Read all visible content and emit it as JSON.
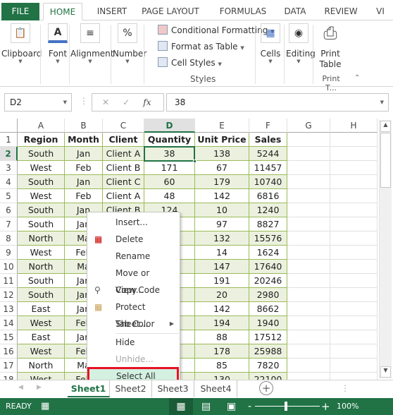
{
  "ribbon_tabs": [
    "FILE",
    "HOME",
    "INSERT",
    "PAGE LAYOUT",
    "FORMULAS",
    "DATA",
    "REVIEW",
    "VI"
  ],
  "groups": {
    "clipboard": "Clipboard",
    "font": "Font",
    "alignment": "Alignment",
    "number": "Number",
    "number_icon": "%",
    "font_icon": "A",
    "styles": {
      "conditional": "Conditional Formatting",
      "format_table": "Format as Table",
      "cell_styles": "Cell Styles",
      "label": "Styles"
    },
    "cells": "Cells",
    "editing": "Editing",
    "print_table": "Print Table",
    "print_label": "Print T..."
  },
  "formula_bar": {
    "name_box": "D2",
    "fx": "fx",
    "value": "38"
  },
  "columns": [
    "A",
    "B",
    "C",
    "D",
    "E",
    "F",
    "G",
    "H"
  ],
  "selected_column": "D",
  "selected_row": "2",
  "table": {
    "headers": [
      "Region",
      "Month",
      "Client",
      "Quantity",
      "Unit Price",
      "Sales"
    ],
    "rows": [
      [
        "South",
        "Jan",
        "Client A",
        "38",
        "138",
        "5244"
      ],
      [
        "West",
        "Feb",
        "Client B",
        "171",
        "67",
        "11457"
      ],
      [
        "South",
        "Jan",
        "Client C",
        "60",
        "179",
        "10740"
      ],
      [
        "West",
        "Feb",
        "Client A",
        "48",
        "142",
        "6816"
      ],
      [
        "South",
        "Jan",
        "Client B",
        "124",
        "10",
        "1240"
      ],
      [
        "South",
        "Jan",
        "",
        "",
        "97",
        "8827"
      ],
      [
        "North",
        "Ma",
        "",
        "",
        "132",
        "15576"
      ],
      [
        "West",
        "Feb",
        "",
        "",
        "14",
        "1624"
      ],
      [
        "North",
        "Ma",
        "",
        "",
        "147",
        "17640"
      ],
      [
        "South",
        "Jan",
        "",
        "",
        "191",
        "20246"
      ],
      [
        "South",
        "Jan",
        "",
        "",
        "20",
        "2980"
      ],
      [
        "East",
        "Jan",
        "",
        "",
        "142",
        "8662"
      ],
      [
        "West",
        "Feb",
        "",
        "",
        "194",
        "1940"
      ],
      [
        "East",
        "Jan",
        "",
        "",
        "88",
        "17512"
      ],
      [
        "West",
        "Feb",
        "",
        "",
        "178",
        "25988"
      ],
      [
        "North",
        "Ma",
        "",
        "",
        "85",
        "7820"
      ],
      [
        "West",
        "Feb",
        "",
        "",
        "130",
        "22100"
      ]
    ]
  },
  "context_menu": [
    {
      "label": "Insert...",
      "icon": "",
      "disabled": false
    },
    {
      "label": "Delete",
      "icon": "delete-sheet-icon",
      "disabled": false
    },
    {
      "label": "Rename",
      "icon": "",
      "disabled": false
    },
    {
      "label": "Move or Copy...",
      "icon": "",
      "disabled": false
    },
    {
      "label": "View Code",
      "icon": "view-code-icon",
      "disabled": false
    },
    {
      "label": "Protect Sheet...",
      "icon": "protect-sheet-icon",
      "disabled": false
    },
    {
      "label": "Tab Color",
      "icon": "",
      "disabled": false,
      "submenu": true
    },
    {
      "label": "Hide",
      "icon": "",
      "disabled": false
    },
    {
      "label": "Unhide...",
      "icon": "",
      "disabled": true
    },
    {
      "label": "Select All Sheets",
      "icon": "",
      "disabled": false,
      "highlighted": true
    }
  ],
  "sheets": [
    "Sheet1",
    "Sheet2",
    "Sheet3",
    "Sheet4"
  ],
  "active_sheet": "Sheet1",
  "status": {
    "mode": "READY",
    "zoom": "100%"
  },
  "colors": {
    "accent": "#217346",
    "band": "#ebf1de",
    "table_border": "#9bbb59",
    "highlight_box": "#e81123"
  }
}
